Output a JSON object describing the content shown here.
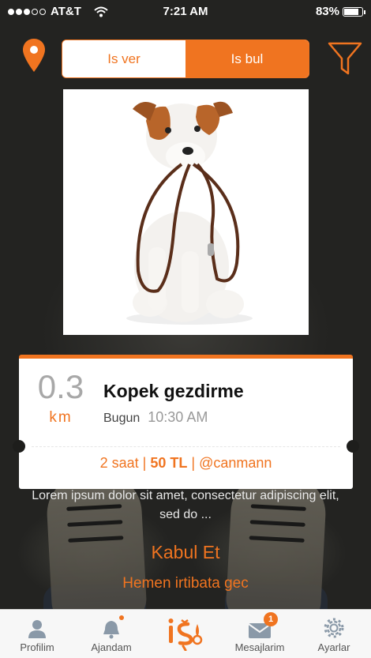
{
  "status_bar": {
    "carrier": "AT&T",
    "time": "7:21 AM",
    "battery": "83%",
    "battery_level": 0.83,
    "signal_bars": 3
  },
  "mode_toggle": {
    "left_label": "Is ver",
    "right_label": "Is bul",
    "selected": "Is bul"
  },
  "listing": {
    "distance_value": "0.3",
    "distance_unit": "km",
    "title": "Kopek gezdirme",
    "day": "Bugun",
    "time": "10:30 AM",
    "duration": "2 saat",
    "price": "50 TL",
    "user": "@canmann",
    "separator": "|",
    "description": "Lorem ipsum dolor sit amet, consectetur adipiscing elit, sed do ..."
  },
  "actions": {
    "accept": "Kabul Et",
    "contact": "Hemen irtibata gec"
  },
  "tabbar": {
    "items": [
      {
        "label": "Profilim",
        "icon": "profile-icon"
      },
      {
        "label": "Ajandam",
        "icon": "bell-icon"
      },
      {
        "label": "",
        "icon": "app-logo-icon"
      },
      {
        "label": "Mesajlarim",
        "icon": "mail-icon",
        "badge": "1"
      },
      {
        "label": "Ayarlar",
        "icon": "gear-icon"
      }
    ]
  },
  "colors": {
    "accent": "#f07420",
    "card": "#ffffff",
    "muted": "#a8a8a8"
  }
}
